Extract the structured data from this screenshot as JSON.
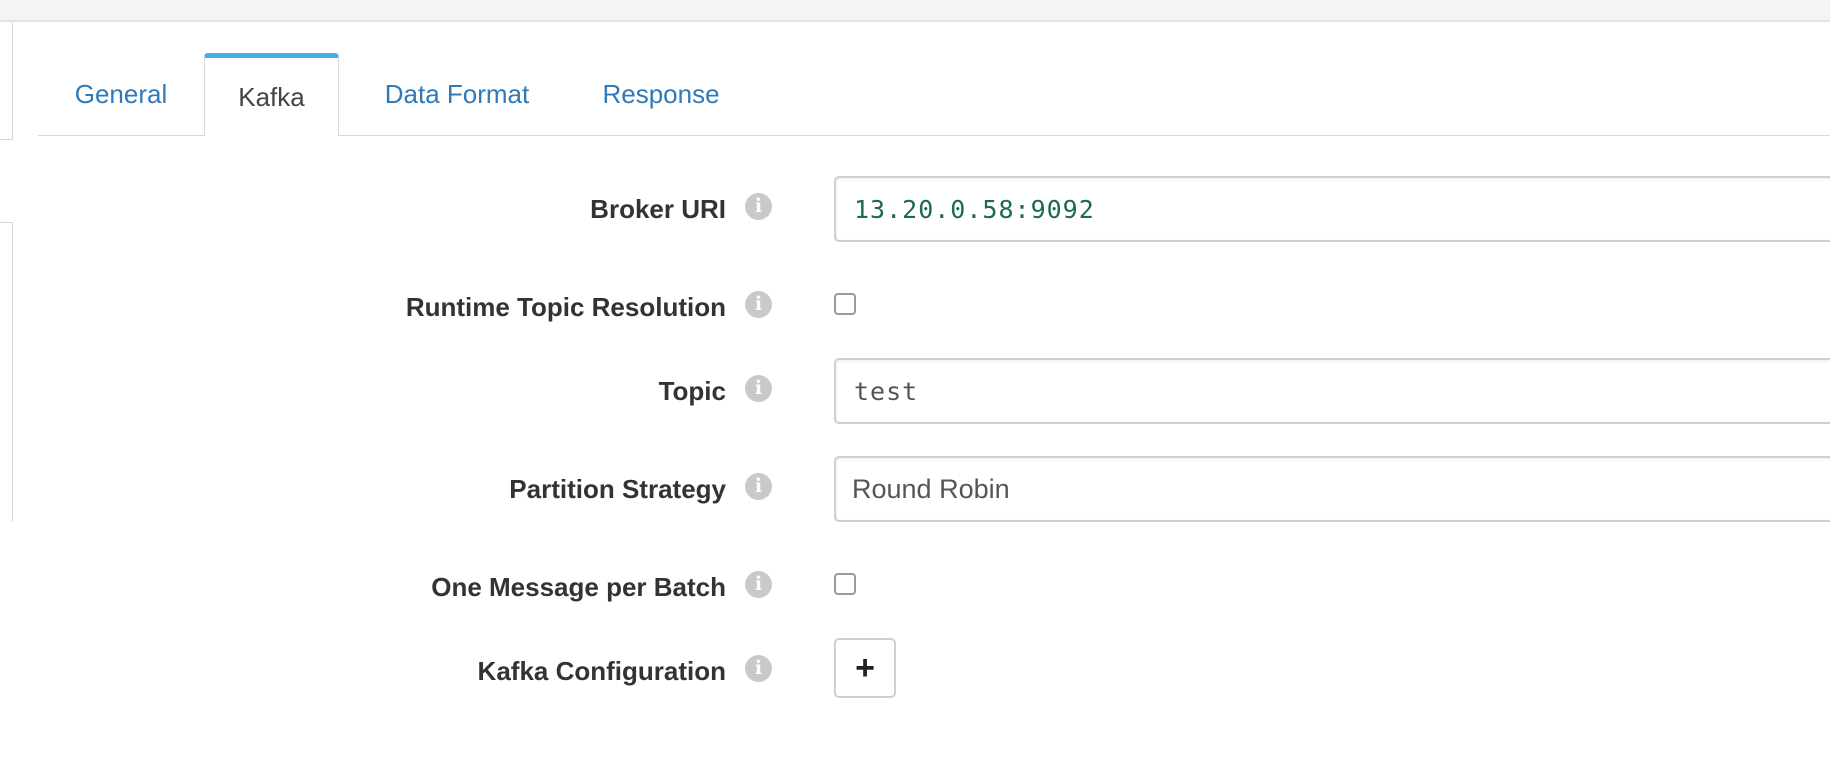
{
  "tabs": [
    {
      "label": "General",
      "active": false
    },
    {
      "label": "Kafka",
      "active": true
    },
    {
      "label": "Data Format",
      "active": false
    },
    {
      "label": "Response",
      "active": false
    }
  ],
  "form": {
    "broker_uri": {
      "label": "Broker URI",
      "value": "13.20.0.58:9092"
    },
    "runtime_topic_resolution": {
      "label": "Runtime Topic Resolution",
      "checked": false
    },
    "topic": {
      "label": "Topic",
      "value": "test"
    },
    "partition_strategy": {
      "label": "Partition Strategy",
      "value": "Round Robin"
    },
    "one_message_per_batch": {
      "label": "One Message per Batch",
      "checked": false
    },
    "kafka_configuration": {
      "label": "Kafka Configuration",
      "add_label": "+"
    }
  },
  "icons": {
    "info": "info-icon",
    "info_glyph": "i"
  },
  "colors": {
    "link": "#2f7ab8",
    "active_tab_accent": "#3fb1e6",
    "value_green": "#1d6b4f"
  }
}
